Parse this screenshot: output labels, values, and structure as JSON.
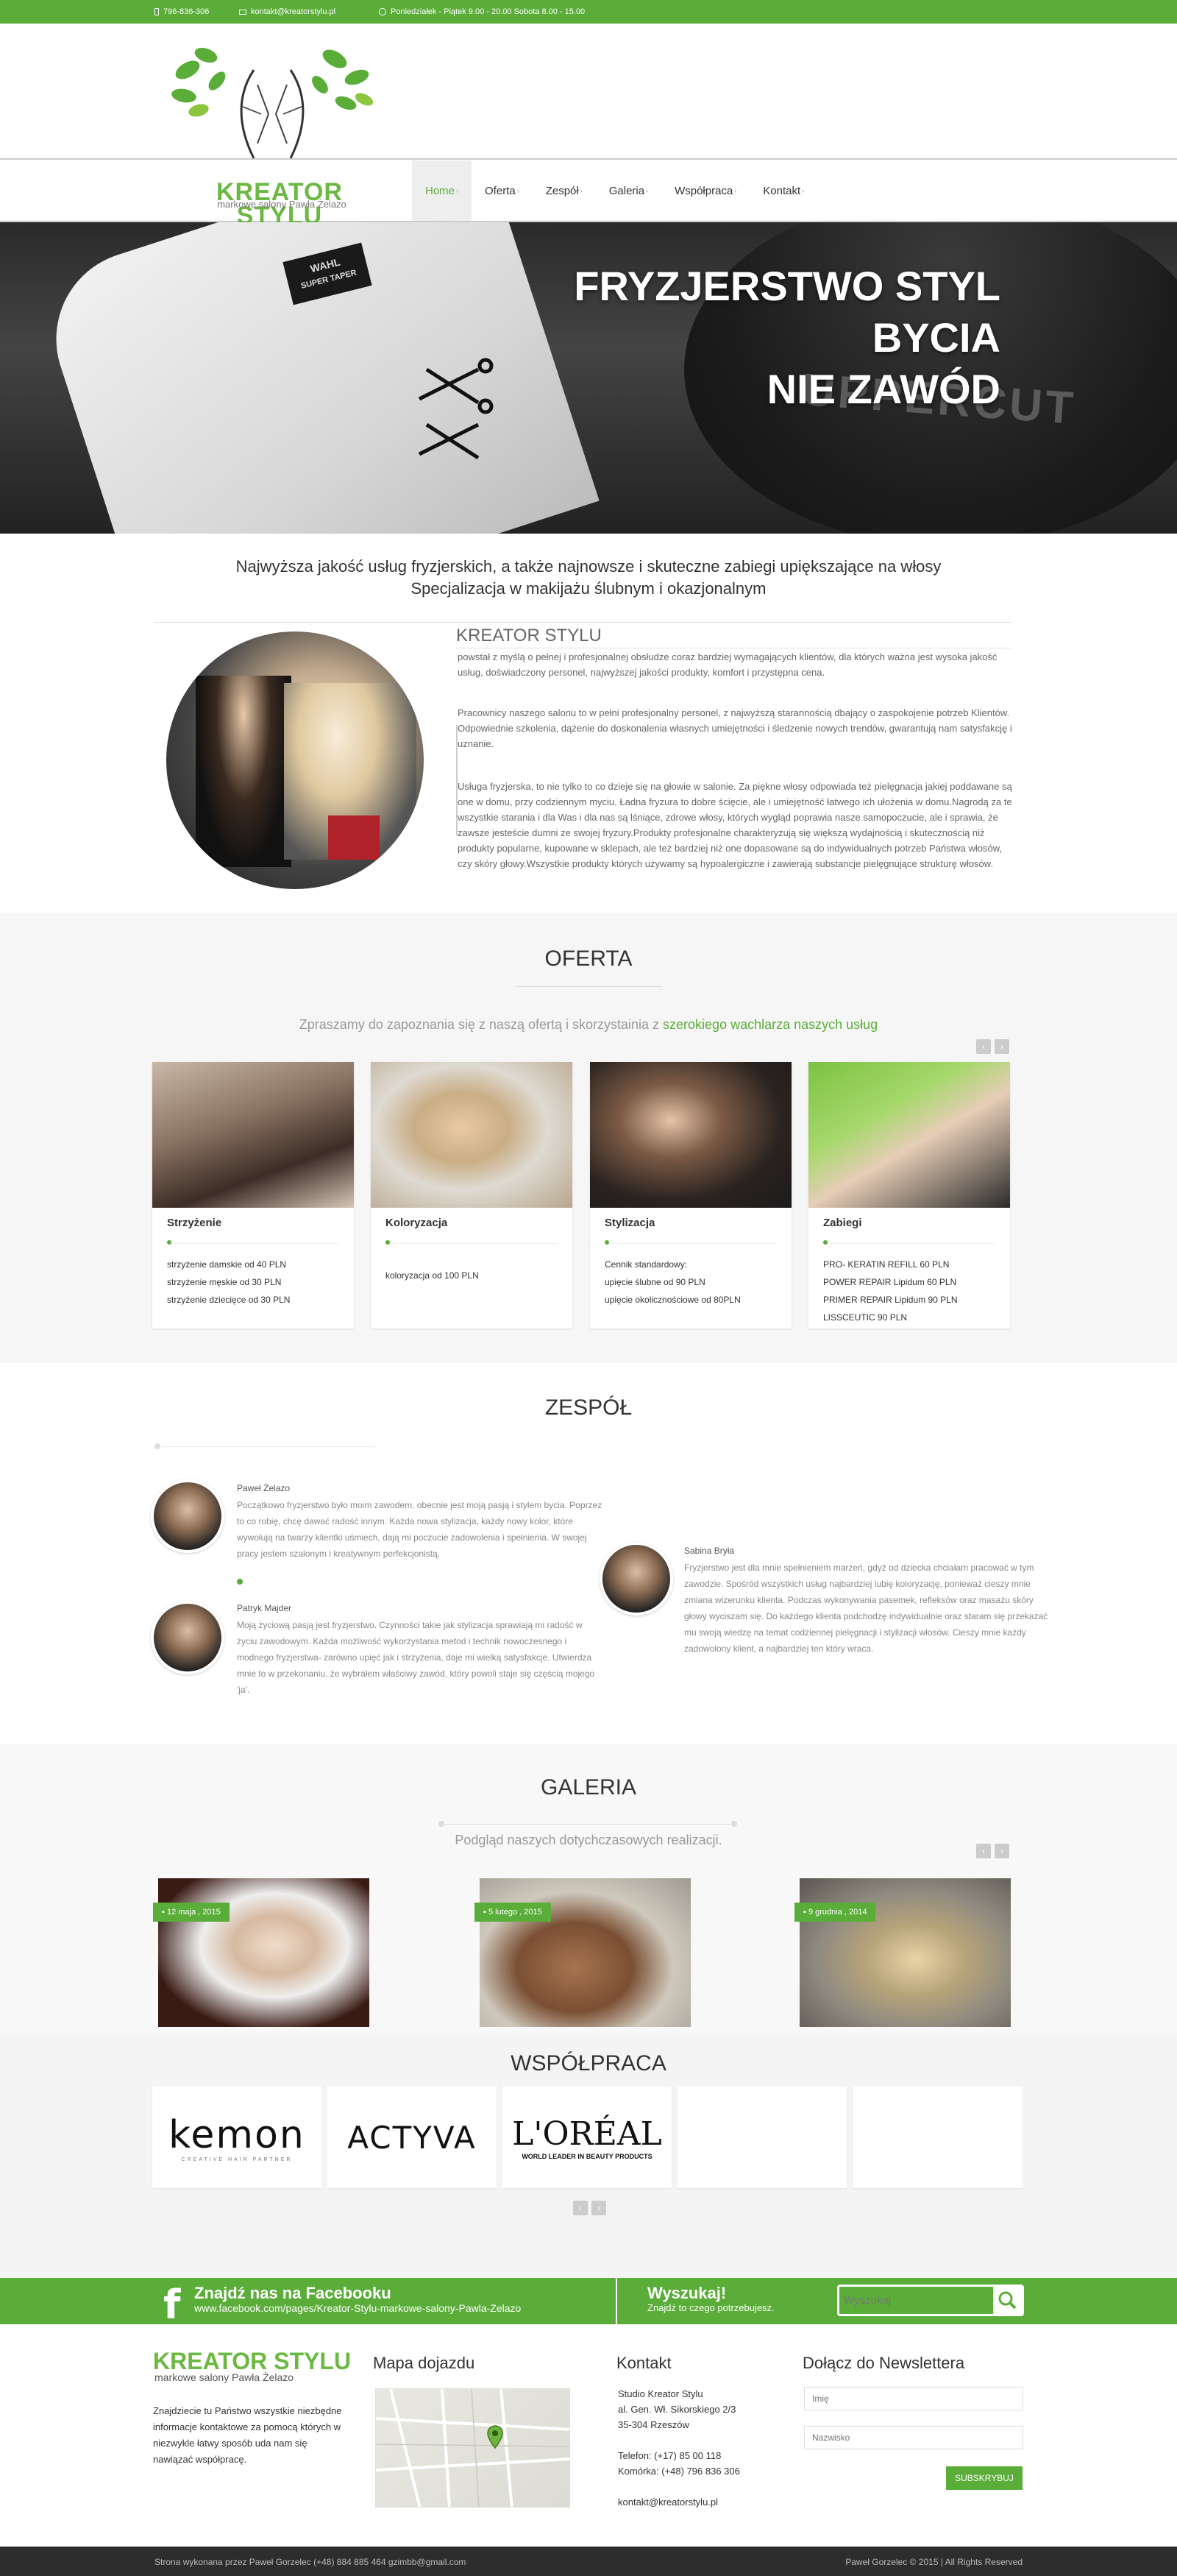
{
  "topbar": {
    "phone": "796-836-306",
    "email": "kontakt@kreatorstylu.pl",
    "hours": "Poniedziałek - Piątek 9.00 - 20.00   Sobota 8.00 - 15.00"
  },
  "logo": {
    "title": "KREATOR STYLU",
    "subtitle": "markowe salony Pawła Żelazo"
  },
  "nav": {
    "items": [
      "Home",
      "Oferta",
      "Zespół",
      "Galeria",
      "Współpraca",
      "Kontakt"
    ],
    "active": "Home",
    "caret": "›"
  },
  "hero": {
    "line1": "FRYZJERSTWO STYL BYCIA",
    "line2": "NIE ZAWÓD",
    "clipper_text1": "WAHL",
    "clipper_text2": "SUPER TAPER",
    "can_text": "UPPERCUT"
  },
  "intro": {
    "heading1": "Najwyższa jakość usług fryzjerskich, a także najnowsze i skuteczne zabiegi upiększające na włosy",
    "heading2": "Specjalizacja w makijażu ślubnym i okazjonalnym",
    "title": "KREATOR STYLU",
    "p1": "powstał z myślą o pełnej i profesjonalnej obsłudze coraz bardziej wymagających klientów, dla których ważna jest wysoka jakość usług, doświadczony personel, najwyższej jakości produkty, komfort i przystępna cena.",
    "p2": "Pracownicy naszego salonu to w pełni profesjonalny personel, z najwyższą starannością dbający o zaspokojenie potrzeb Klientów. Odpowiednie szkolenia, dążenie do doskonalenia własnych umiejętności i śledzenie nowych trendów, gwarantują nam satysfakcję i uznanie.",
    "p3": "Usługa fryzjerska, to nie tylko to co dzieje się na głowie w salonie. Za piękne włosy odpowiada też pielęgnacja jakiej poddawane są one w domu, przy codziennym myciu. Ładna fryzura to dobre ścięcie, ale i umiejętność łatwego ich ułożenia w domu.Nagrodą za te wszystkie starania i dla Was i dla nas są lśniące, zdrowe włosy, których wygląd poprawia nasze samopoczucie, ale i sprawia, że zawsze jesteście dumni ze swojej fryzury.Produkty profesjonalne charakteryzują się większą wydajnością i skutecznością niż produkty popularne, kupowane w sklepach, ale też bardziej niż one dopasowane są do indywidualnych potrzeb Państwa włosów, czy skóry głowy.Wszystkie produkty których używamy są hypoalergiczne i zawierają substancje pielęgnujące strukturę włosów."
  },
  "offer": {
    "heading": "OFERTA",
    "sub_plain": "Zpraszamy do zapoznania się z naszą ofertą i skorzystainia z ",
    "sub_green": "szerokiego wachlarza naszych usług",
    "prev": "‹",
    "next": "›",
    "cards": [
      {
        "title": "Strzyżenie",
        "items": [
          "strzyżenie damskie od 40 PLN",
          "strzyżenie męskie od 30 PLN",
          "strzyżenie dziecięce od 30 PLN"
        ]
      },
      {
        "title": "Koloryzacja",
        "items": [
          "koloryzacja od 100 PLN"
        ]
      },
      {
        "title": "Stylizacja",
        "items": [
          "Cennik standardowy:",
          "upięcie ślubne od 90 PLN",
          "upięcie okolicznościowe od 80PLN"
        ]
      },
      {
        "title": "Zabiegi",
        "items": [
          "PRO- KERATIN REFILL 60 PLN",
          "POWER REPAIR Lipidum 60 PLN",
          "PRIMER REPAIR Lipidum 90 PLN",
          "LISSCEUTIC 90 PLN"
        ]
      }
    ]
  },
  "team": {
    "heading": "ZESPÓŁ",
    "members": [
      {
        "name": "Paweł Żelazo",
        "text": "Początkowo fryzjerstwo było moim zawodem, obecnie jest moją pasją i stylem bycia. Poprzez to co robię, chcę dawać radość innym. Każda nowa stylizacja, każdy nowy kolor, które wywołują na twarzy klientki uśmiech, dają mi poczucie zadowolenia i spełnienia. W swojej pracy jestem szalonym i kreatywnym perfekcjonistą."
      },
      {
        "name": "Patryk Majder",
        "text": "Moją życiową pasją jest fryzjerstwo. Czynności takie jak stylizacja sprawiają mi radość w życiu zawodowym. Każda możliwość wykorzystania metod i technik nowoczesnego i modnego fryzjerstwa- zarówno upięć jak i strzyżenia, daje mi wielką satysfakcje. Utwierdza mnie to w przekonaniu, że wybrałem właściwy zawód, który powoli staje się częścią mojego 'ja'."
      },
      {
        "name": "Sabina Bryła",
        "text": "Fryzjerstwo jest dla mnie spełnieniem marzeń, gdyż od dziecka chciałam pracować w tym zawodzie. Spośród wszystkich usług najbardziej lubię koloryzację, ponieważ cieszy mnie zmiana wizerunku klienta. Podczas wykonywania pasemek, refleksów oraz masażu skóry głowy wyciszam się. Do każdego klienta podchodzę indywidualnie oraz staram się przekazać mu swoją wiedzę na temat codziennej pielęgnacji i stylizacji włosów. Cieszy mnie każdy zadowolony klient, a najbardziej ten który wraca."
      }
    ]
  },
  "gallery": {
    "heading": "GALERIA",
    "sub": "Podgląd naszych dotychczasowych realizacji.",
    "prev": "‹",
    "next": "›",
    "items": [
      {
        "date": "12 maja , 2015"
      },
      {
        "date": "5 lutego , 2015"
      },
      {
        "date": "9 grudnia , 2014"
      }
    ]
  },
  "partners": {
    "heading": "WSPÓŁPRACA",
    "logos": [
      "kemon",
      "ACTYVA",
      "L'ORÉAL"
    ],
    "loreal_sub": "WORLD LEADER IN BEAUTY PRODUCTS",
    "kemon_sub": "CREATIVE HAIR PARTNER",
    "prev": "‹",
    "next": "›"
  },
  "facebook": {
    "icon": "f",
    "title": "Znajdź nas na Facebooku",
    "url": "www.facebook.com/pages/Kreator-Stylu-markowe-salony-Pawla-Zelazo",
    "search_title": "Wyszukaj!",
    "search_sub": "Znajdź to czego potrzebujesz.",
    "search_placeholder": "Wyszukaj"
  },
  "footer": {
    "logo_title": "KREATOR STYLU",
    "logo_sub": "markowe salony Pawła Żelazo",
    "about": "Znajdziecie tu Państwo wszystkie niezbędne informacje kontaktowe za pomocą których w niezwykle łatwy sposób uda nam się nawiązać współpracę.",
    "map_title": "Mapa dojazdu",
    "contact_title": "Kontakt",
    "contact_lines": [
      "Studio Kreator Stylu",
      "al. Gen. Wł. Sikorskiego 2/3",
      "35-304 Rzeszów",
      "",
      "Telefon:    (+17)  85 00 118",
      "Komórka: (+48) 796 836 306",
      "",
      "kontakt@kreatorstylu.pl"
    ],
    "newsletter_title": "Dołącz do Newslettera",
    "name_placeholder": "Imię",
    "surname_placeholder": "Nazwisko",
    "subscribe": "SUBSKRYBUJ"
  },
  "bottom": {
    "left": "Strona wykonana przez Paweł Gorzelec   (+48) 884 885 464   gzimbb@gmail.com",
    "right": "Paweł Gorzelec © 2015 | All Rights Reserved"
  },
  "colors": {
    "accent": "#5aad39",
    "dark": "#2d2d2d"
  }
}
